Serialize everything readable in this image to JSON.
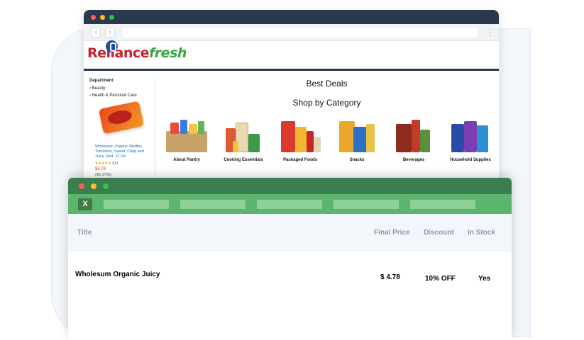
{
  "site": {
    "logo": {
      "part1": "Reliance",
      "part2": "fresh"
    },
    "sidebar": {
      "heading": "Department",
      "items": [
        "Beauty",
        "Health & Personal Care"
      ]
    },
    "featured": {
      "name": "Wholesum Organic Medley Tomatoes, Sweet, Crisp and Juicy, Red, 12 Oz",
      "stars": "★★★★★",
      "rating_count": "321",
      "price": "$4.78",
      "unit_price": "($6.37/lb)"
    },
    "best_deals": "Best Deals",
    "shop_by_category": "Shop by Category",
    "categories": [
      {
        "label": "About Pantry"
      },
      {
        "label": "Cooking Essentials"
      },
      {
        "label": "Packaged Foods"
      },
      {
        "label": "Snacks"
      },
      {
        "label": "Beverages"
      },
      {
        "label": "Household Supplies"
      }
    ]
  },
  "spreadsheet": {
    "app_icon": "X",
    "columns": {
      "title": "Title",
      "final_price": "Final Price",
      "discount": "Discount",
      "in_stock": "In Stock"
    },
    "rows": [
      {
        "title": "Wholesum Organic Juicy",
        "final_price": "$ 4.78",
        "discount": "10% OFF",
        "in_stock": "Yes"
      }
    ]
  },
  "colors": {
    "brand_red": "#cc1f2f",
    "brand_green": "#37a845",
    "sheet_green": "#5cb56d",
    "sheet_dark_green": "#3c7d4f",
    "browser_dark": "#2b3950"
  }
}
